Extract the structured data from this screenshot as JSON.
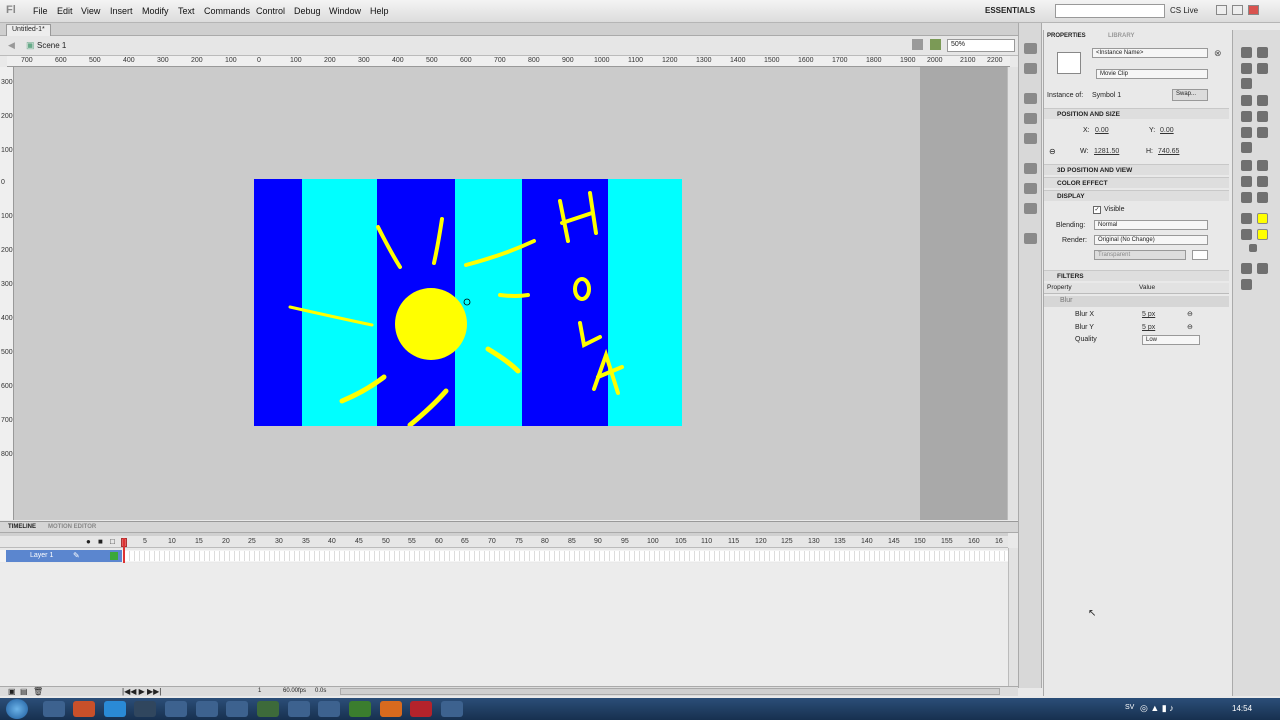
{
  "app": {
    "logo": "Fl"
  },
  "menu": [
    "File",
    "Edit",
    "View",
    "Insert",
    "Modify",
    "Text",
    "Commands",
    "Control",
    "Debug",
    "Window",
    "Help"
  ],
  "workspace": {
    "label": "ESSENTIALS",
    "live": "CS Live"
  },
  "doc": {
    "tab": "Untitled-1*",
    "scene": "Scene 1",
    "zoom": "50%"
  },
  "hruler": [
    "700",
    "600",
    "500",
    "400",
    "300",
    "200",
    "100",
    "0",
    "100",
    "200",
    "300",
    "400",
    "500",
    "600",
    "700",
    "800",
    "900",
    "1000",
    "1100",
    "1200",
    "1300",
    "1400",
    "1500",
    "1600",
    "1700",
    "1800",
    "1900",
    "2000",
    "2100",
    "2200"
  ],
  "vruler": [
    "300",
    "200",
    "100",
    "0",
    "100",
    "200",
    "300",
    "400",
    "500",
    "600",
    "700",
    "800"
  ],
  "stage_text": "HOLA",
  "colors": {
    "blue": "#0000ff",
    "cyan": "#00ffff",
    "yellow": "#ffff00"
  },
  "timeline": {
    "tabs": [
      "TIMELINE",
      "MOTION EDITOR"
    ],
    "frames": [
      "5",
      "10",
      "15",
      "20",
      "25",
      "30",
      "35",
      "40",
      "45",
      "50",
      "55",
      "60",
      "65",
      "70",
      "75",
      "80",
      "85",
      "90",
      "95",
      "100",
      "105",
      "110",
      "115",
      "120",
      "125",
      "130",
      "135",
      "140",
      "145",
      "150",
      "155",
      "160",
      "16"
    ],
    "layer": "Layer 1",
    "fps": "60.00fps",
    "time": "0.0s",
    "frame": "1"
  },
  "props": {
    "tabs": [
      "PROPERTIES",
      "LIBRARY"
    ],
    "instance_name": "<Instance Name>",
    "type": "Movie Clip",
    "instance_of_label": "Instance of:",
    "instance_of": "Symbol 1",
    "swap": "Swap...",
    "pos_header": "POSITION AND SIZE",
    "x_label": "X:",
    "x": "0.00",
    "y_label": "Y:",
    "y": "0.00",
    "w_label": "W:",
    "w": "1281.50",
    "h_label": "H:",
    "h": "740.65",
    "sec_3d": "3D POSITION AND VIEW",
    "sec_color": "COLOR EFFECT",
    "sec_display": "DISPLAY",
    "visible": "Visible",
    "blending_label": "Blending:",
    "blending": "Normal",
    "render_label": "Render:",
    "render": "Original (No Change)",
    "transparent": "Transparent",
    "sec_filters": "FILTERS",
    "col_property": "Property",
    "col_value": "Value",
    "filter": "Blur",
    "blurx_label": "Blur X",
    "blurx": "5 px",
    "blury_label": "Blur Y",
    "blury": "5 px",
    "quality_label": "Quality",
    "quality": "Low"
  },
  "taskbar": {
    "lang": "SV",
    "clock": "14:54"
  }
}
